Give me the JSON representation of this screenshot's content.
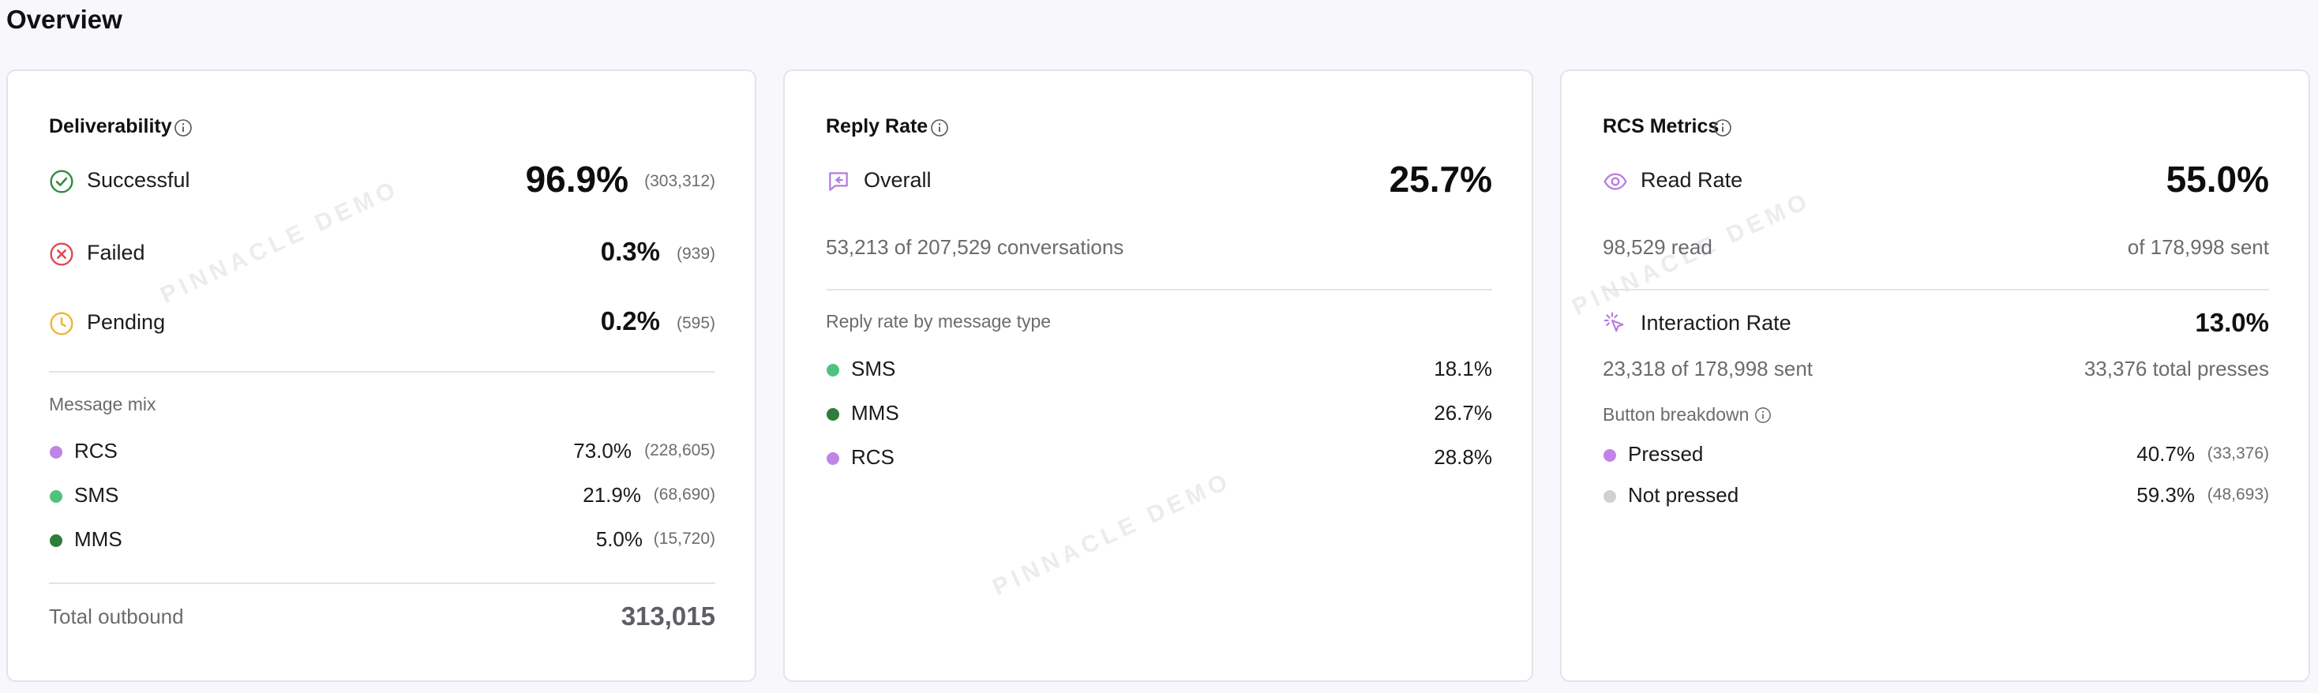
{
  "page": {
    "title": "Overview"
  },
  "watermark": "PINNACLE DEMO",
  "deliverability": {
    "title": "Deliverability",
    "rows": [
      {
        "label": "Successful",
        "pct": "96.9%",
        "count": "(303,312)"
      },
      {
        "label": "Failed",
        "pct": "0.3%",
        "count": "(939)"
      },
      {
        "label": "Pending",
        "pct": "0.2%",
        "count": "(595)"
      }
    ],
    "mix_label": "Message mix",
    "mix": [
      {
        "label": "RCS",
        "pct": "73.0%",
        "count": "(228,605)",
        "color": "#c084e8"
      },
      {
        "label": "SMS",
        "pct": "21.9%",
        "count": "(68,690)",
        "color": "#4fc27f"
      },
      {
        "label": "MMS",
        "pct": "5.0%",
        "count": "(15,720)",
        "color": "#2e7d3a"
      }
    ],
    "total_label": "Total outbound",
    "total_value": "313,015"
  },
  "reply": {
    "title": "Reply Rate",
    "overall_label": "Overall",
    "overall_value": "25.7%",
    "conversations": "53,213 of 207,529 conversations",
    "by_type_label": "Reply rate by message type",
    "types": [
      {
        "label": "SMS",
        "pct": "18.1%",
        "color": "#4fc27f"
      },
      {
        "label": "MMS",
        "pct": "26.7%",
        "color": "#2e7d3a"
      },
      {
        "label": "RCS",
        "pct": "28.8%",
        "color": "#c084e8"
      }
    ]
  },
  "rcs": {
    "title": "RCS Metrics",
    "read_label": "Read Rate",
    "read_value": "55.0%",
    "read_count": "98,529 read",
    "read_of": "of 178,998 sent",
    "interaction_label": "Interaction Rate",
    "interaction_value": "13.0%",
    "interaction_count": "23,318 of 178,998 sent",
    "interaction_presses": "33,376 total presses",
    "breakdown_label": "Button breakdown",
    "buttons": [
      {
        "label": "Pressed",
        "pct": "40.7%",
        "count": "(33,376)",
        "color": "#c084e8"
      },
      {
        "label": "Not pressed",
        "pct": "59.3%",
        "count": "(48,693)",
        "color": "#d0d0d4"
      }
    ]
  },
  "colors": {
    "success": "#2e8b3e",
    "failed": "#e0484e",
    "pending": "#f2b530",
    "accent": "#b57be0"
  },
  "icons": {
    "info": "info-circle-icon",
    "successful": "check-circle-icon",
    "failed": "x-circle-icon",
    "pending": "clock-icon",
    "overall": "reply-message-icon",
    "read": "eye-icon",
    "interaction": "cursor-click-icon"
  }
}
